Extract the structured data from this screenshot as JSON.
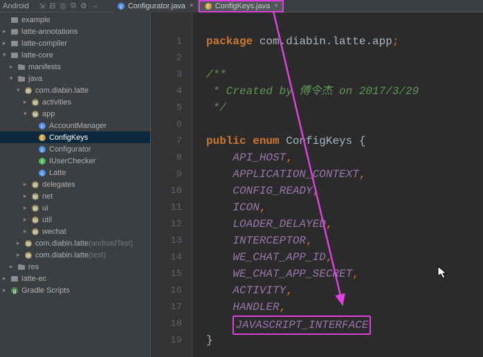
{
  "topbar": {
    "project": "Android",
    "tabs": [
      {
        "label": "Configurator.java",
        "active": false
      },
      {
        "label": "ConfigKeys.java",
        "active": true
      }
    ]
  },
  "sidebar": {
    "items": [
      {
        "label": "example",
        "indent": 0,
        "chev": "",
        "icon": "module",
        "class": ""
      },
      {
        "label": "latte-annotations",
        "indent": 0,
        "chev": "▸",
        "icon": "module",
        "class": ""
      },
      {
        "label": "latte-compiler",
        "indent": 0,
        "chev": "▸",
        "icon": "module",
        "class": ""
      },
      {
        "label": "latte-core",
        "indent": 0,
        "chev": "▾",
        "icon": "module",
        "class": ""
      },
      {
        "label": "manifests",
        "indent": 1,
        "chev": "▸",
        "icon": "folder",
        "class": ""
      },
      {
        "label": "java",
        "indent": 1,
        "chev": "▾",
        "icon": "folder",
        "class": ""
      },
      {
        "label": "com.diabin.latte",
        "indent": 2,
        "chev": "▾",
        "icon": "package",
        "class": ""
      },
      {
        "label": "activities",
        "indent": 3,
        "chev": "▸",
        "icon": "package",
        "class": ""
      },
      {
        "label": "app",
        "indent": 3,
        "chev": "▾",
        "icon": "package",
        "class": ""
      },
      {
        "label": "AccountManager",
        "indent": 4,
        "chev": "",
        "icon": "class",
        "class": ""
      },
      {
        "label": "ConfigKeys",
        "indent": 4,
        "chev": "",
        "icon": "enum",
        "class": "selected"
      },
      {
        "label": "Configurator",
        "indent": 4,
        "chev": "",
        "icon": "class",
        "class": ""
      },
      {
        "label": "IUserChecker",
        "indent": 4,
        "chev": "",
        "icon": "interface",
        "class": ""
      },
      {
        "label": "Latte",
        "indent": 4,
        "chev": "",
        "icon": "class",
        "class": ""
      },
      {
        "label": "delegates",
        "indent": 3,
        "chev": "▸",
        "icon": "package",
        "class": ""
      },
      {
        "label": "net",
        "indent": 3,
        "chev": "▸",
        "icon": "package",
        "class": ""
      },
      {
        "label": "ui",
        "indent": 3,
        "chev": "▸",
        "icon": "package",
        "class": ""
      },
      {
        "label": "util",
        "indent": 3,
        "chev": "▸",
        "icon": "package",
        "class": ""
      },
      {
        "label": "wechat",
        "indent": 3,
        "chev": "▸",
        "icon": "package",
        "class": ""
      },
      {
        "label": "com.diabin.latte",
        "suffix": " (androidTest)",
        "indent": 2,
        "chev": "▸",
        "icon": "package",
        "class": ""
      },
      {
        "label": "com.diabin.latte",
        "suffix": " (test)",
        "indent": 2,
        "chev": "▸",
        "icon": "package",
        "class": ""
      },
      {
        "label": "res",
        "indent": 1,
        "chev": "▸",
        "icon": "folder",
        "class": ""
      },
      {
        "label": "latte-ec",
        "indent": 0,
        "chev": "▸",
        "icon": "module",
        "class": ""
      },
      {
        "label": "Gradle Scripts",
        "indent": 0,
        "chev": "▸",
        "icon": "gradle",
        "class": ""
      }
    ]
  },
  "code": {
    "package_kw": "package",
    "package_name": "com.diabin.latte.app",
    "comment_open": "/**",
    "comment_line": " * Created by 傅令杰 on 2017/3/29",
    "comment_close": " */",
    "public_kw": "public",
    "enum_kw": "enum",
    "class_name": "ConfigKeys",
    "brace_open": "{",
    "brace_close": "}",
    "fields": [
      "API_HOST",
      "APPLICATION_CONTEXT",
      "CONFIG_READY",
      "ICON",
      "LOADER_DELAYED",
      "INTERCEPTOR",
      "WE_CHAT_APP_ID",
      "WE_CHAT_APP_SECRET",
      "ACTIVITY",
      "HANDLER",
      "JAVASCRIPT_INTERFACE"
    ],
    "max_line": 19
  }
}
